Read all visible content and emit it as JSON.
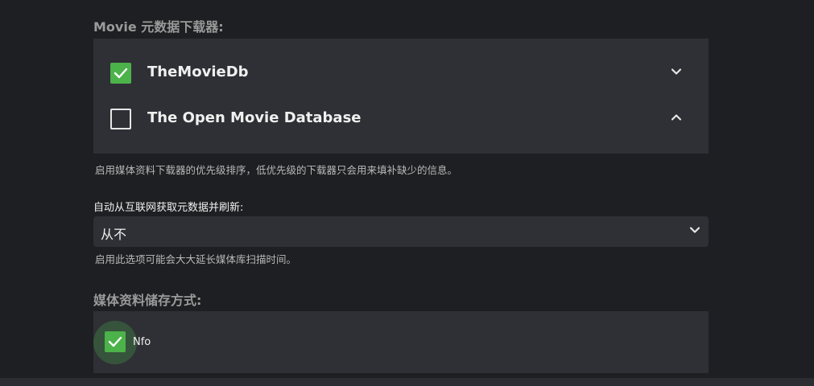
{
  "metadata_fetchers": {
    "title": "Movie 元数据下载器:",
    "items": [
      {
        "name": "TheMovieDb",
        "checked": true,
        "chevron": "chevron-down-icon"
      },
      {
        "name": "The Open Movie Database",
        "checked": false,
        "chevron": "chevron-up-icon"
      }
    ],
    "help": "启用媒体资料下载器的优先级排序，低优先级的下载器只会用来填补缺少的信息。"
  },
  "auto_refresh": {
    "label": "自动从互联网获取元数据并刷新:",
    "value": "从不",
    "help": "启用此选项可能会大大延长媒体库扫描时间。"
  },
  "metadata_savers": {
    "title": "媒体资料储存方式:",
    "items": [
      {
        "name": "Nfo",
        "checked": true
      }
    ]
  },
  "colors": {
    "background": "#1e1f22",
    "panel": "#2f3035",
    "accent": "#4cb24a"
  }
}
